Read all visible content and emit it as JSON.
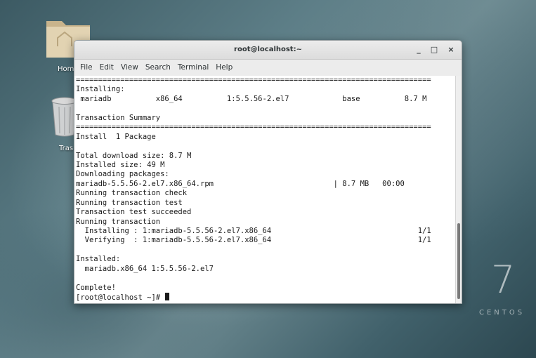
{
  "desktop": {
    "home_label": "Hom",
    "trash_label": "Tras",
    "brand_number": "7",
    "brand_word": "CENTOS"
  },
  "window": {
    "title": "root@localhost:~",
    "minimize": "_",
    "maximize": "□",
    "close": "×"
  },
  "menu": [
    "File",
    "Edit",
    "View",
    "Search",
    "Terminal",
    "Help"
  ],
  "terminal": {
    "lines": [
      "================================================================================",
      "Installing:",
      " mariadb          x86_64          1:5.5.56-2.el7            base          8.7 M",
      "",
      "Transaction Summary",
      "================================================================================",
      "Install  1 Package",
      "",
      "Total download size: 8.7 M",
      "Installed size: 49 M",
      "Downloading packages:",
      "mariadb-5.5.56-2.el7.x86_64.rpm                           | 8.7 MB   00:00",
      "Running transaction check",
      "Running transaction test",
      "Transaction test succeeded",
      "Running transaction",
      "  Installing : 1:mariadb-5.5.56-2.el7.x86_64                                 1/1",
      "  Verifying  : 1:mariadb-5.5.56-2.el7.x86_64                                 1/1",
      "",
      "Installed:",
      "  mariadb.x86_64 1:5.5.56-2.el7",
      "",
      "Complete!"
    ],
    "prompt": "[root@localhost ~]# "
  }
}
